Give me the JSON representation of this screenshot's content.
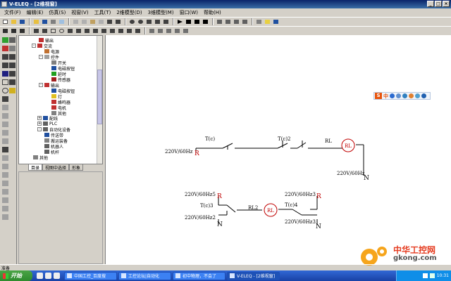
{
  "window": {
    "title": "V-ELEQ - [2维视窗]"
  },
  "menu": [
    "文件(F)",
    "编辑(E)",
    "仿真(S)",
    "视窗(V)",
    "工具(T)",
    "2维模型(D)",
    "3维模型(M)",
    "窗口(W)",
    "帮助(H)"
  ],
  "tree": {
    "items": [
      {
        "label": "输出",
        "level": 3
      },
      {
        "label": "交流",
        "level": 2,
        "expander": "-"
      },
      {
        "label": "电源",
        "level": 3
      },
      {
        "label": "控件",
        "level": 3,
        "expander": "-"
      },
      {
        "label": "开关",
        "level": 4
      },
      {
        "label": "电磁按钮",
        "level": 4
      },
      {
        "label": "延时",
        "level": 4
      },
      {
        "label": "传感器",
        "level": 4
      },
      {
        "label": "输出",
        "level": 3,
        "expander": "-"
      },
      {
        "label": "电磁按钮",
        "level": 4
      },
      {
        "label": "灯",
        "level": 4
      },
      {
        "label": "蜂鸣器",
        "level": 4
      },
      {
        "label": "电机",
        "level": 4
      },
      {
        "label": "其他",
        "level": 4
      },
      {
        "label": "",
        "level": 1
      },
      {
        "label": "配线",
        "level": 1,
        "expander": "+"
      },
      {
        "label": "PLC",
        "level": 1,
        "expander": "+"
      },
      {
        "label": "自动化设备",
        "level": 1,
        "expander": "-"
      },
      {
        "label": "传送带",
        "level": 2
      },
      {
        "label": "搬运装备",
        "level": 2
      },
      {
        "label": "机器人",
        "level": 2
      },
      {
        "label": "机杆",
        "level": 2
      },
      {
        "label": "其他",
        "level": 1
      }
    ]
  },
  "tabs": [
    "目录",
    "视图中选择",
    "形象"
  ],
  "status": {
    "text": "准备"
  },
  "circuit": {
    "labels": {
      "tc1": "T(c)",
      "tc2": "T(c)2",
      "rl": "RL",
      "src1": "220V/60Hz",
      "src1_term": "R",
      "src1_out": "220V/60Hz",
      "src1_out_term": "N",
      "src5": "220V/60Hz5",
      "src5_term": "R",
      "tc3": "T(c)3",
      "rl2": "RL2",
      "tc4": "T(c)4",
      "src3": "220V/60Hz3",
      "src3_term": "R",
      "src2": "220V/60Hz2",
      "src2_term": "N",
      "src3b": "220V/60Hz3",
      "src3b_term": "N",
      "lamp1": "RL",
      "lamp2": "RL"
    }
  },
  "ime": {
    "logo": "S",
    "letter": "中"
  },
  "watermark": {
    "title": "中华工控网",
    "sub": "gkong.com"
  },
  "taskbar": {
    "start": "开始",
    "tasks": [
      "中国工控_百度搜",
      "工控论坛|自动化",
      "初中物理，不会了",
      "V-ELEQ - [2维视窗]"
    ],
    "clock": "10:31"
  },
  "colors": {
    "accent": "#0a246a",
    "wire": "#000000",
    "terminal": "#c00000",
    "lamp": "#c00000"
  }
}
